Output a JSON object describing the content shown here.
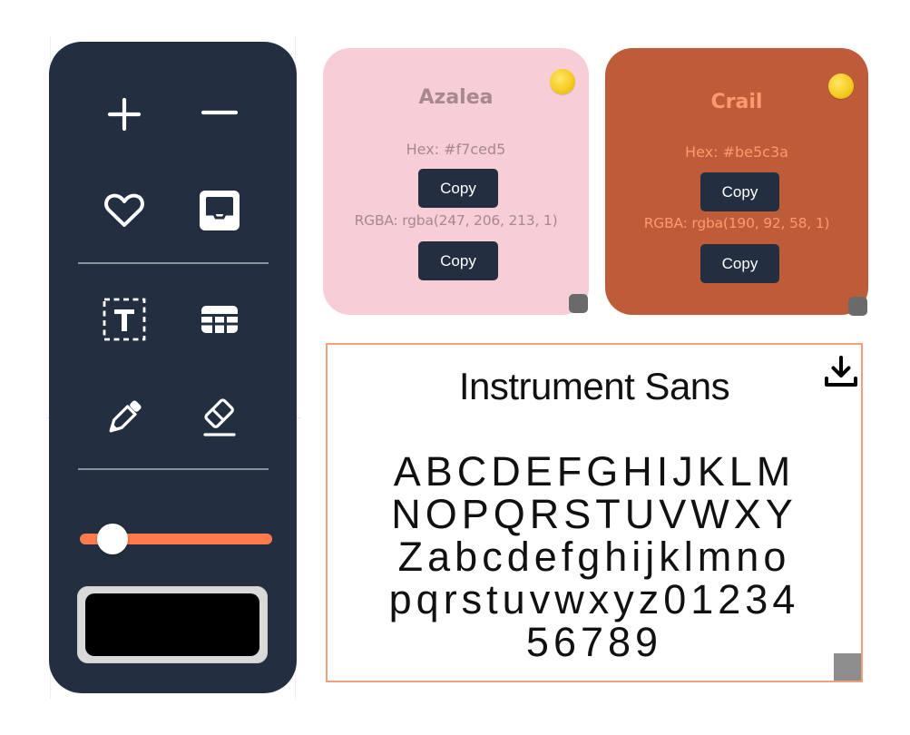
{
  "toolbar": {
    "tools": [
      {
        "name": "add-icon"
      },
      {
        "name": "remove-icon"
      },
      {
        "name": "heart-icon"
      },
      {
        "name": "inbox-icon"
      },
      {
        "name": "text-box-icon"
      },
      {
        "name": "table-icon"
      },
      {
        "name": "pen-icon"
      },
      {
        "name": "eraser-icon"
      }
    ],
    "slider_value": 0.17,
    "slider_colors": {
      "track": "#ff7a4d",
      "thumb": "#ffffff"
    },
    "selected_color": "#000000",
    "background": "#232e40"
  },
  "cards": [
    {
      "name": "Azalea",
      "hex_line": "Hex: #f7ced5",
      "rgba_line": "RGBA: rgba(247, 206, 213, 1)",
      "copy_label": "Copy",
      "background": "#f7ced5",
      "text_color": "#a78890"
    },
    {
      "name": "Crail",
      "hex_line": "Hex: #be5c3a",
      "rgba_line": "RGBA: rgba(190, 92, 58, 1)",
      "copy_label": "Copy",
      "background": "#be5c3a",
      "text_color": "#fb9a6e"
    }
  ],
  "font_card": {
    "title": "Instrument Sans",
    "glyph_lines": [
      "ABCDEFGHIJKLM",
      "NOPQRSTUVWXY",
      "Zabcdefghijklmno",
      "pqrstuvwxyz01234",
      "56789"
    ],
    "border_color": "#f1a07a",
    "download_icon": "download-icon"
  }
}
